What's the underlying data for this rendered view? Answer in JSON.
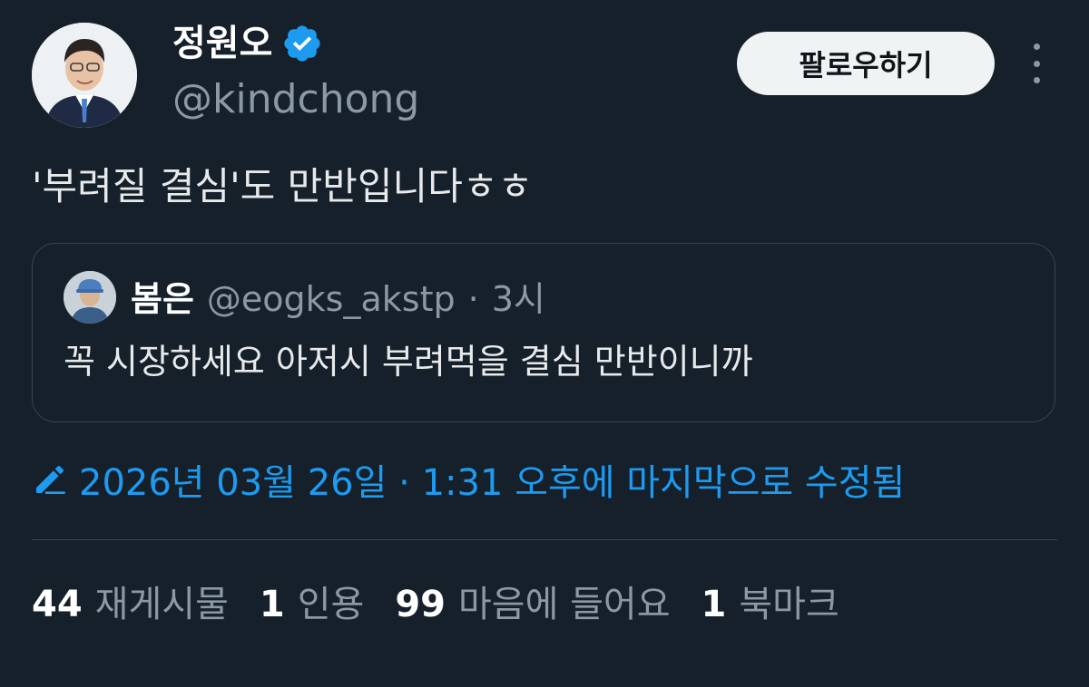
{
  "author": {
    "display_name": "정원오",
    "handle": "@kindchong",
    "verified": true,
    "avatar_icon": "person-avatar-photo"
  },
  "follow_label": "팔로우하기",
  "more_icon": "more-vertical-icon",
  "tweet_text": "'부려질 결심'도 만반입니다ㅎㅎ",
  "quote": {
    "display_name": "봄은",
    "handle": "@eogks_akstp",
    "separator": "·",
    "time": "3시",
    "text": "꼭 시장하세요 아저시 부려먹을 결심 만반이니까"
  },
  "edited_label": "2026년 03월 26일 · 1:31 오후에 마지막으로 수정됨",
  "stats": [
    {
      "num": "44",
      "label": "재게시물"
    },
    {
      "num": "1",
      "label": "인용"
    },
    {
      "num": "99",
      "label": "마음에 들어요"
    },
    {
      "num": "1",
      "label": "북마크"
    }
  ],
  "colors": {
    "background": "#15202b",
    "accent": "#1d9bf0",
    "muted_text": "#8b98a5",
    "border": "#38444d"
  }
}
